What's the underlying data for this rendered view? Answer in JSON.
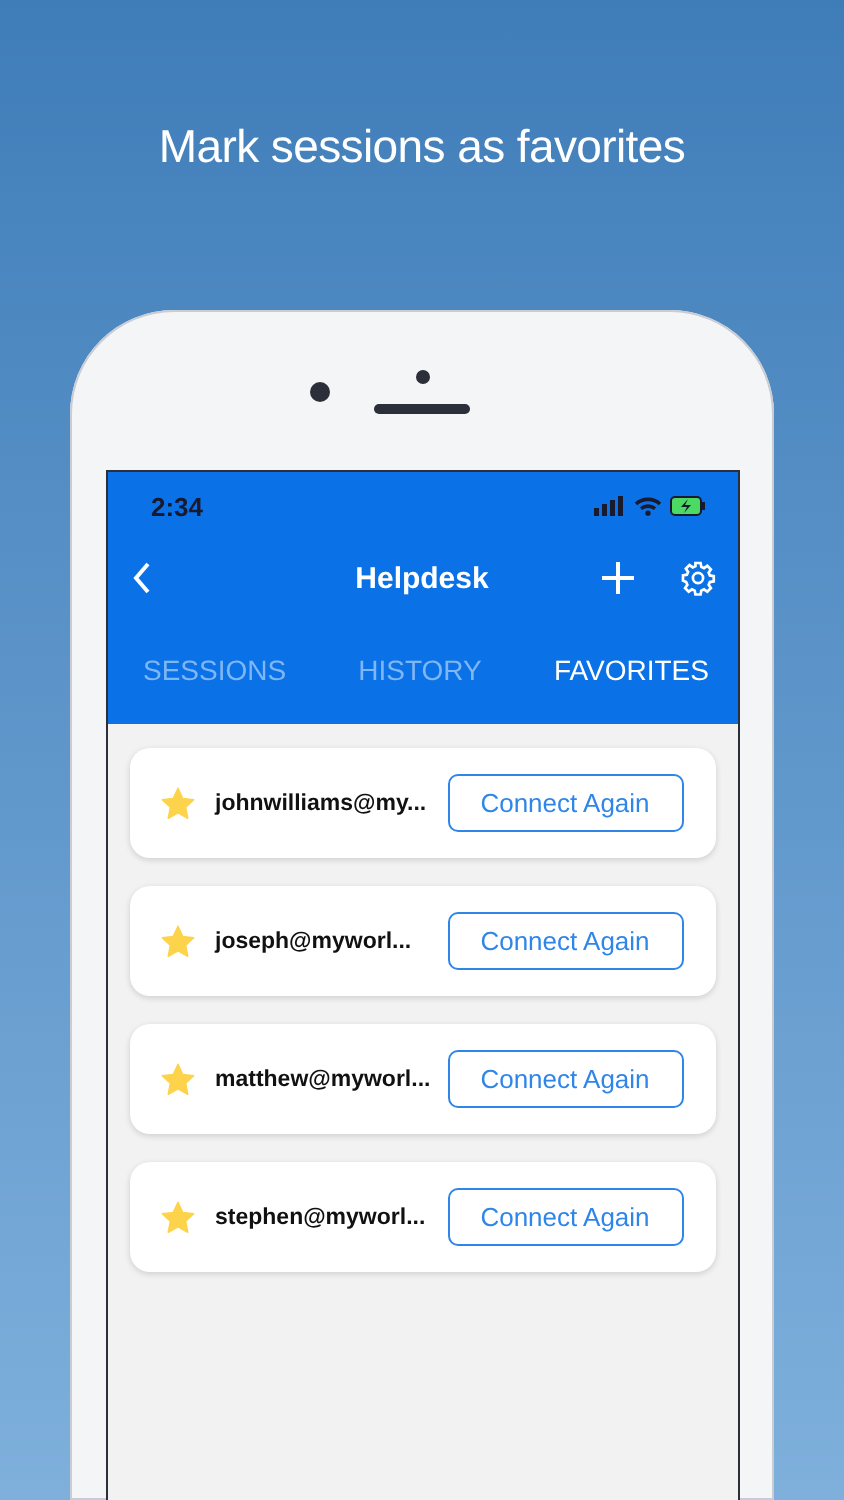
{
  "headline": "Mark sessions as favorites",
  "status_bar": {
    "time": "2:34"
  },
  "nav": {
    "title": "Helpdesk"
  },
  "tabs": [
    {
      "label": "SESSIONS",
      "selected": false
    },
    {
      "label": "HISTORY",
      "selected": false
    },
    {
      "label": "FAVORITES",
      "selected": true
    }
  ],
  "favorites": [
    {
      "email": "johnwilliams@my...",
      "favorite": true,
      "button": "Connect Again"
    },
    {
      "email": "joseph@myworl...",
      "favorite": true,
      "button": "Connect Again"
    },
    {
      "email": "matthew@myworl...",
      "favorite": true,
      "button": "Connect Again"
    },
    {
      "email": "stephen@myworl...",
      "favorite": true,
      "button": "Connect Again"
    }
  ]
}
